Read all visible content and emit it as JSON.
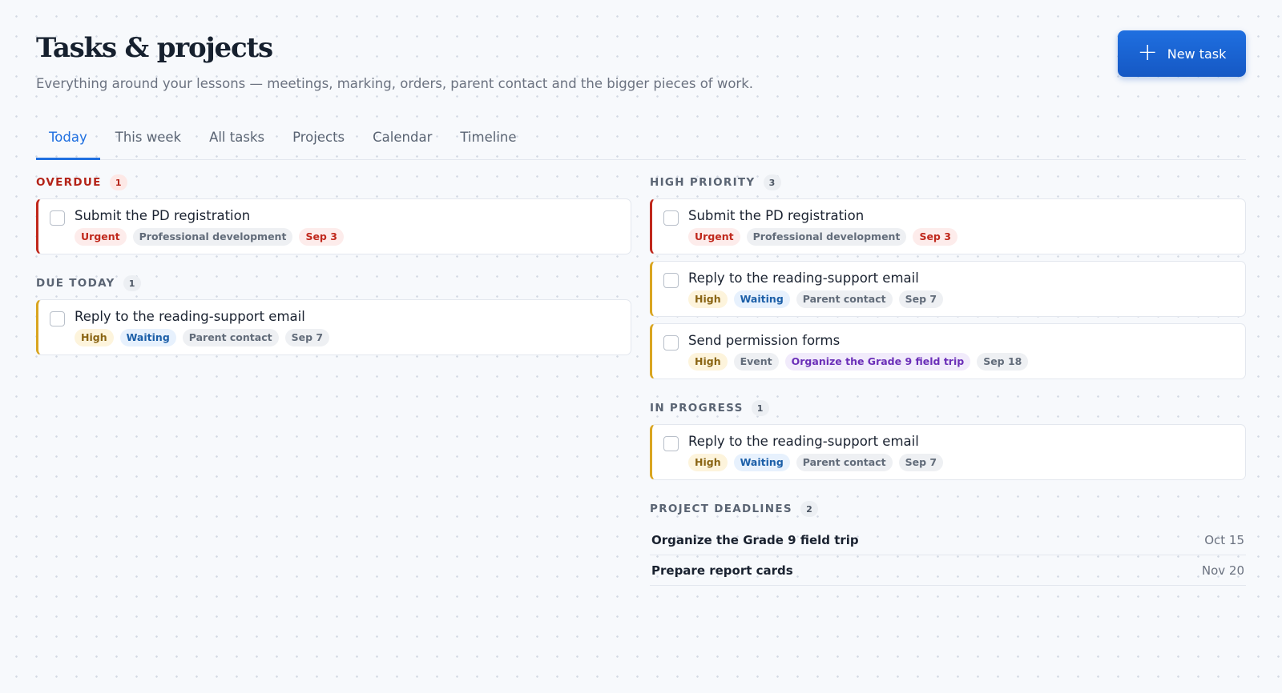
{
  "header": {
    "title": "Tasks & projects",
    "subtitle": "Everything around your lessons — meetings, marking, orders, parent contact and the bigger pieces of work.",
    "new_task_label": "New task"
  },
  "tabs": [
    {
      "label": "Today",
      "active": true
    },
    {
      "label": "This week"
    },
    {
      "label": "All tasks"
    },
    {
      "label": "Projects"
    },
    {
      "label": "Calendar"
    },
    {
      "label": "Timeline"
    }
  ],
  "sections": {
    "overdue": {
      "label": "OVERDUE",
      "count": "1",
      "tasks": [
        {
          "title": "Submit the PD registration",
          "tags": [
            "Urgent",
            "Professional development",
            "Sep 3"
          ]
        }
      ]
    },
    "due_today": {
      "label": "DUE TODAY",
      "count": "1",
      "tasks": [
        {
          "title": "Reply to the reading-support email",
          "tags": [
            "High",
            "Waiting",
            "Parent contact",
            "Sep 7"
          ]
        }
      ]
    },
    "high_priority": {
      "label": "HIGH PRIORITY",
      "count": "3",
      "tasks": [
        {
          "title": "Submit the PD registration",
          "tags": [
            "Urgent",
            "Professional development",
            "Sep 3"
          ]
        },
        {
          "title": "Reply to the reading-support email",
          "tags": [
            "High",
            "Waiting",
            "Parent contact",
            "Sep 7"
          ]
        },
        {
          "title": "Send permission forms",
          "tags": [
            "High",
            "Event",
            "Organize the Grade 9 field trip",
            "Sep 18"
          ]
        }
      ]
    },
    "in_progress": {
      "label": "IN PROGRESS",
      "count": "1",
      "tasks": [
        {
          "title": "Reply to the reading-support email",
          "tags": [
            "High",
            "Waiting",
            "Parent contact",
            "Sep 7"
          ]
        }
      ]
    },
    "project_deadlines": {
      "label": "PROJECT DEADLINES",
      "count": "2",
      "items": [
        {
          "name": "Organize the Grade 9 field trip",
          "date": "Oct 15"
        },
        {
          "name": "Prepare report cards",
          "date": "Nov 20"
        }
      ]
    }
  },
  "colors": {
    "accent": "#1f6fe0",
    "urgent": "#c0281c",
    "high": "#d9a520"
  }
}
